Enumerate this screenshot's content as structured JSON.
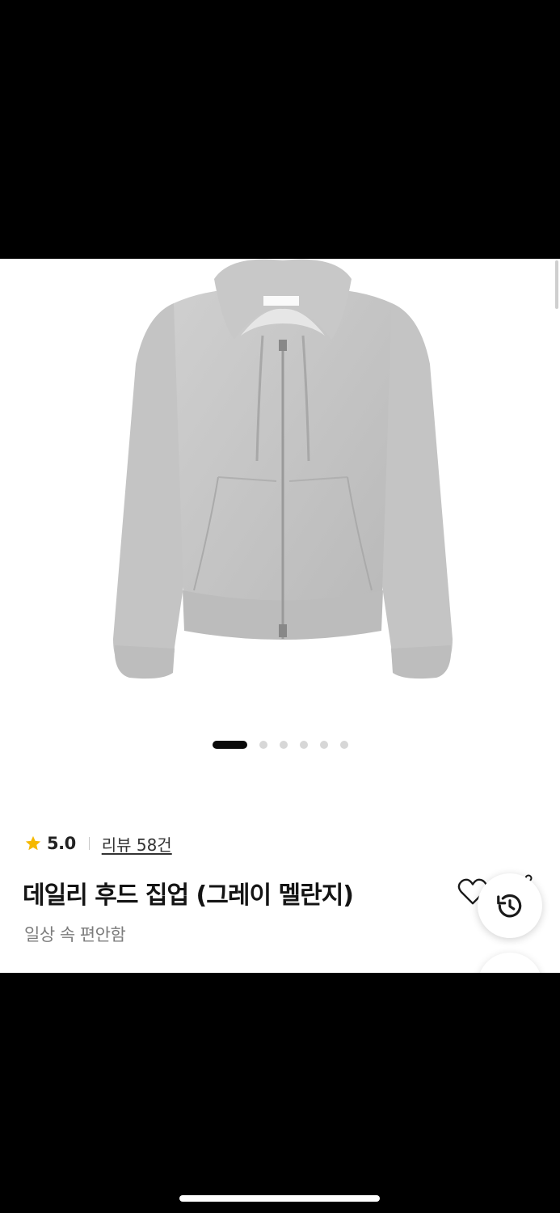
{
  "product": {
    "rating": "5.0",
    "review_label": "리뷰 58건",
    "title": "데일리 후드 집업 (그레이 멜란지)",
    "subtitle": "일상 속 편안함"
  },
  "carousel": {
    "total_pages": 6,
    "active_index": 0
  },
  "icons": {
    "rating": "star-icon",
    "wishlist": "heart-icon",
    "share": "share-icon",
    "recent": "history-icon"
  },
  "colors": {
    "star": "#f5b800",
    "title": "#141414",
    "subtitle": "#7c7c7c",
    "active_dot": "#0a0a0a",
    "inactive_dot": "#d7d7d7"
  }
}
